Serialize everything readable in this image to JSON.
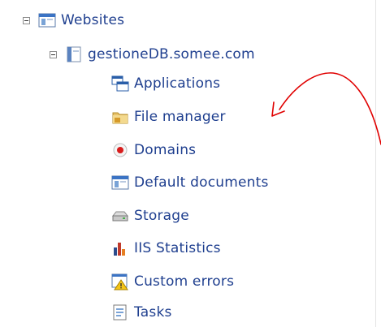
{
  "tree": {
    "root": {
      "label": "Websites",
      "icon": "website-folder-icon",
      "expanded": true
    },
    "site": {
      "label": "gestioneDB.somee.com",
      "icon": "site-icon",
      "expanded": true
    },
    "items": [
      {
        "label": "Applications",
        "icon": "applications-icon"
      },
      {
        "label": "File manager",
        "icon": "folder-icon"
      },
      {
        "label": "Domains",
        "icon": "domains-icon"
      },
      {
        "label": "Default documents",
        "icon": "default-documents-icon"
      },
      {
        "label": "Storage",
        "icon": "storage-icon"
      },
      {
        "label": "IIS Statistics",
        "icon": "statistics-icon"
      },
      {
        "label": "Custom errors",
        "icon": "custom-errors-icon"
      },
      {
        "label": "Tasks",
        "icon": "tasks-icon"
      }
    ]
  },
  "annotation": {
    "color": "#e00000",
    "icon": "red-curved-arrow",
    "points_to": "File manager"
  },
  "colors": {
    "link": "#1f3f8f"
  }
}
